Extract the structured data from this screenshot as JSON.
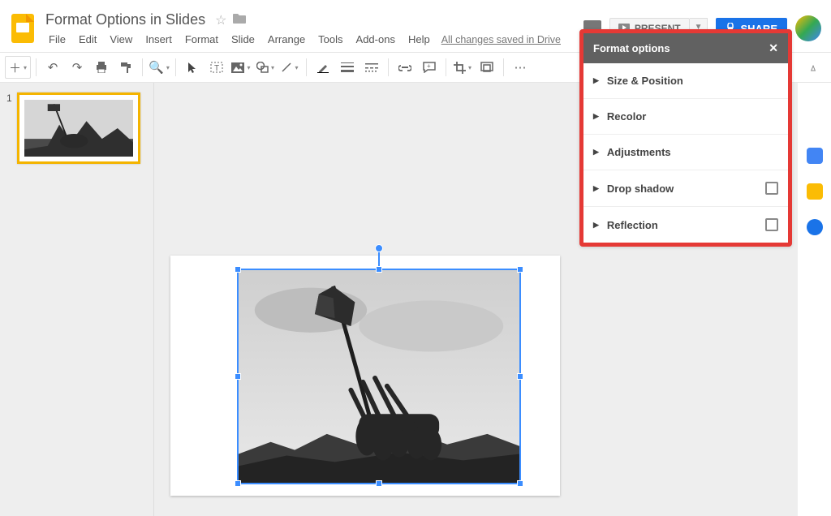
{
  "doc": {
    "title": "Format Options in Slides",
    "save_status": "All changes saved in Drive"
  },
  "menus": {
    "file": "File",
    "edit": "Edit",
    "view": "View",
    "insert": "Insert",
    "format": "Format",
    "slide": "Slide",
    "arrange": "Arrange",
    "tools": "Tools",
    "addons": "Add-ons",
    "help": "Help"
  },
  "header": {
    "present": "PRESENT",
    "share": "SHARE"
  },
  "filmstrip": {
    "thumb_number": "1"
  },
  "format_panel": {
    "title": "Format options",
    "sections": {
      "size_position": "Size & Position",
      "recolor": "Recolor",
      "adjustments": "Adjustments",
      "drop_shadow": "Drop shadow",
      "reflection": "Reflection"
    }
  }
}
